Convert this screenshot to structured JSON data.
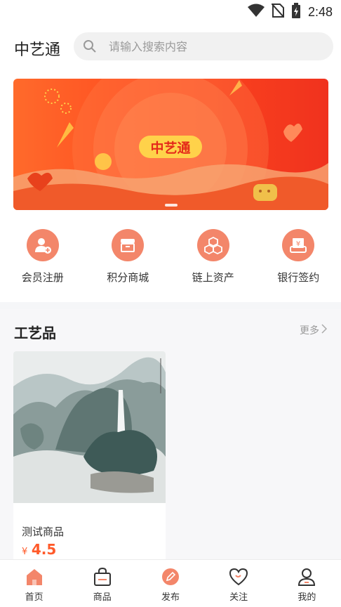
{
  "status_bar": {
    "time": "2:48"
  },
  "header": {
    "title": "中艺通"
  },
  "search": {
    "placeholder": "请输入搜索内容"
  },
  "banner": {
    "logo_text": "中艺通"
  },
  "quick_menu": [
    {
      "label": "会员注册",
      "icon": "member-register-icon"
    },
    {
      "label": "积分商城",
      "icon": "points-mall-icon"
    },
    {
      "label": "链上资产",
      "icon": "chain-assets-icon"
    },
    {
      "label": "银行签约",
      "icon": "bank-sign-icon"
    }
  ],
  "section": {
    "title": "工艺品",
    "more_label": "更多",
    "products": [
      {
        "name": "测试商品",
        "currency": "¥",
        "price": "4.5",
        "image": "landscape-painting"
      }
    ]
  },
  "tab_bar": [
    {
      "label": "首页",
      "icon": "home-icon",
      "active": true
    },
    {
      "label": "商品",
      "icon": "shopping-bag-icon",
      "active": false
    },
    {
      "label": "发布",
      "icon": "publish-icon",
      "active": false
    },
    {
      "label": "关注",
      "icon": "heart-icon",
      "active": false
    },
    {
      "label": "我的",
      "icon": "profile-icon",
      "active": false
    }
  ],
  "colors": {
    "accent": "#f3866a",
    "price": "#ff5a2a",
    "banner": "#ff4a1f"
  }
}
